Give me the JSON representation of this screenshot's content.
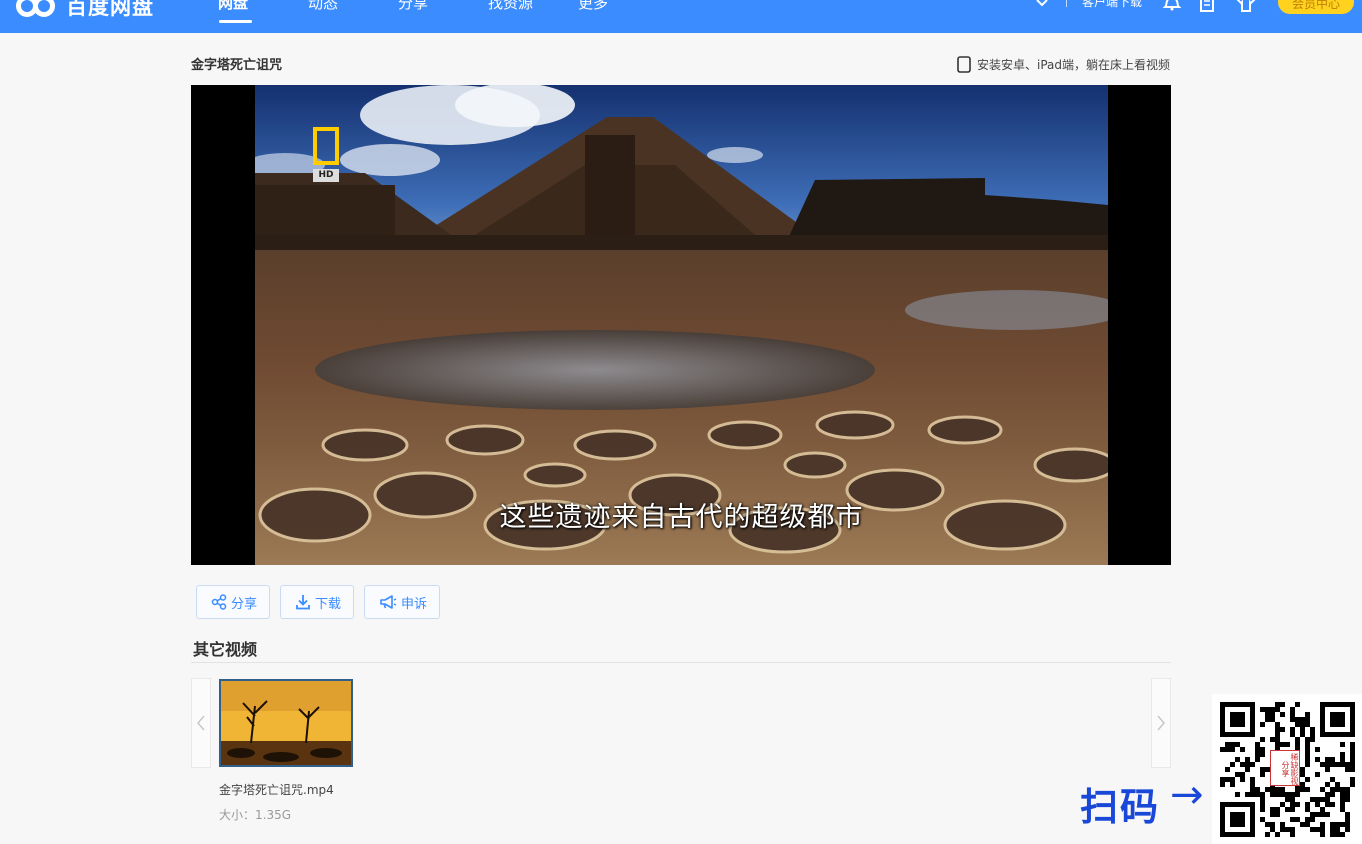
{
  "header": {
    "logo_text": "百度网盘",
    "nav": [
      {
        "label": "网盘",
        "active": true
      },
      {
        "label": "动态",
        "active": false
      },
      {
        "label": "分享",
        "active": false
      },
      {
        "label": "找资源",
        "active": false
      },
      {
        "label": "更多",
        "active": false
      }
    ],
    "client_download": "客户端下载",
    "vip_center": "会员中心",
    "icons": [
      "chevron-down-icon",
      "bell-icon",
      "notes-icon",
      "tshirt-icon"
    ]
  },
  "page": {
    "title": "金字塔死亡诅咒",
    "install_tip": "安装安卓、iPad端，躺在床上看视频"
  },
  "player": {
    "subtitle": "这些遗迹来自古代的超级都市",
    "badge": "HD"
  },
  "actions": [
    {
      "label": "分享",
      "icon": "share-icon"
    },
    {
      "label": "下载",
      "icon": "download-icon"
    },
    {
      "label": "申诉",
      "icon": "megaphone-icon"
    }
  ],
  "other_videos": {
    "title": "其它视频",
    "items": [
      {
        "name": "金字塔死亡诅咒.mp4",
        "size": "大小：1.35G"
      }
    ]
  },
  "overlay": {
    "scan_text": "扫码",
    "arrow": "→",
    "qr_badge": "稀缺影视分享"
  },
  "colors": {
    "topbar": "#3b8cff",
    "accent": "#3b8cff",
    "vip": "#ffd21f",
    "overlay_text": "#1947d8"
  }
}
